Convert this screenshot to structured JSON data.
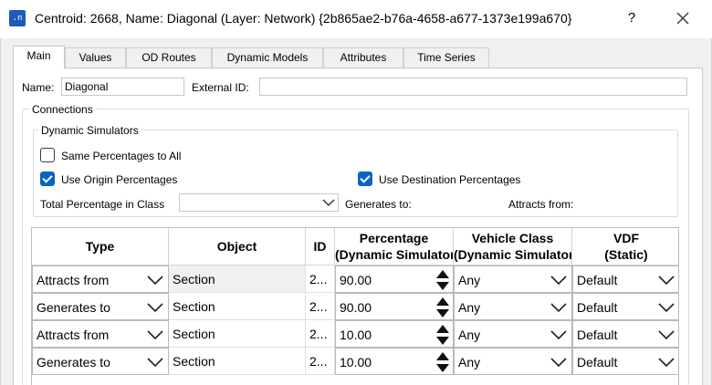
{
  "window": {
    "title": "Centroid: 2668, Name: Diagonal (Layer: Network) {2b865ae2-b76a-4658-a677-1373e199a670}",
    "app_icon_text": ".n",
    "help_label": "?",
    "close_icon": "close-icon"
  },
  "tabs": [
    {
      "label": "Main",
      "active": true
    },
    {
      "label": "Values"
    },
    {
      "label": "OD Routes"
    },
    {
      "label": "Dynamic Models"
    },
    {
      "label": "Attributes"
    },
    {
      "label": "Time Series"
    }
  ],
  "main": {
    "name_label": "Name:",
    "name_value": "Diagonal",
    "external_id_label": "External ID:",
    "external_id_value": "",
    "connections_label": "Connections",
    "dynamic_simulators_label": "Dynamic Simulators",
    "same_percentages": {
      "label": "Same Percentages to All",
      "checked": false
    },
    "use_origin": {
      "label": "Use Origin Percentages",
      "checked": true
    },
    "use_destination": {
      "label": "Use Destination Percentages",
      "checked": true
    },
    "total_percentage_label": "Total Percentage in Class",
    "total_percentage_value": "",
    "generates_to_label": "Generates to:",
    "attracts_from_label": "Attracts from:"
  },
  "grid": {
    "headers": {
      "type": "Type",
      "object": "Object",
      "id": "ID",
      "percentage_line1": "Percentage",
      "percentage_line2": "(Dynamic Simulators)",
      "vehicle_line1": "Vehicle Class",
      "vehicle_line2": "(Dynamic Simulators)",
      "vdf_line1": "VDF",
      "vdf_line2": "(Static)"
    },
    "rows": [
      {
        "type": "Attracts from",
        "object": "Section",
        "id": "2...",
        "percentage": "90.00",
        "vehicle": "Any",
        "vdf": "Default"
      },
      {
        "type": "Generates to",
        "object": "Section",
        "id": "2...",
        "percentage": "90.00",
        "vehicle": "Any",
        "vdf": "Default"
      },
      {
        "type": "Attracts from",
        "object": "Section",
        "id": "2...",
        "percentage": "10.00",
        "vehicle": "Any",
        "vdf": "Default"
      },
      {
        "type": "Generates to",
        "object": "Section",
        "id": "2...",
        "percentage": "10.00",
        "vehicle": "Any",
        "vdf": "Default"
      }
    ]
  },
  "colors": {
    "accent": "#0a64c6",
    "app_icon": "#1e5bb8",
    "window_bg": "#f0f0f0",
    "selected_cell": "#f0f0f0"
  }
}
